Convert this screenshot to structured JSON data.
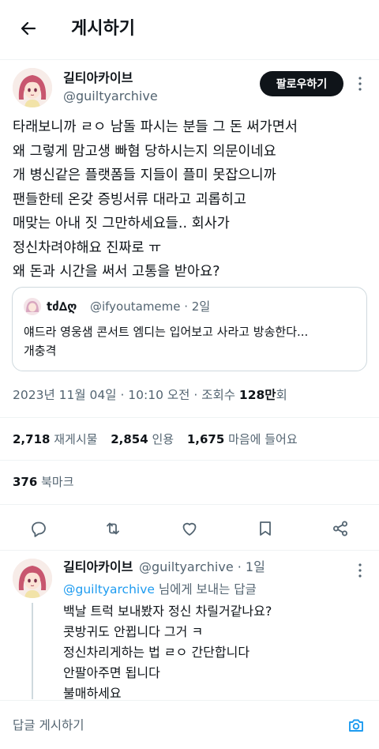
{
  "header": {
    "title": "게시하기",
    "back_icon": "arrow-left-icon"
  },
  "tweet": {
    "author_name": "길티아카이브",
    "author_handle": "@guiltyarchive",
    "follow_label": "팔로우하기",
    "body_lines": [
      "타래보니까 ㄹㅇ 남돌 파시는 분들 그 돈 써가면서",
      "왜 그렇게 맘고생 빠혐 당하시는지 의문이네요",
      "개 병신같은 플랫폼들 지들이 플미 못잡으니까",
      "팬들한테 온갖 증빙서류 대라고 괴롭히고",
      "매맞는 아내 짓 그만하세요들.. 회사가",
      "정신차려야해요 진짜로 ㅠ",
      "왜 돈과 시간을 써서 고통을 받아요?"
    ],
    "quote": {
      "name": "tძ∆ღ",
      "handle": "@ifyoutameme · 2일",
      "text_lines": [
        "얘드라 영웅샘 콘서트 엠디는 입어보고 사라고 방송한다...",
        "개충격"
      ]
    },
    "meta": {
      "datetime": "2023년 11월 04일 · 10:10 오전 · 조회수 ",
      "views": "128만",
      "views_unit": "회"
    },
    "stats": {
      "retweets": "2,718",
      "retweets_label": "재게시물",
      "quotes": "2,854",
      "quotes_label": "인용",
      "likes": "1,675",
      "likes_label": "마음에 들어요"
    },
    "bookmarks": {
      "count": "376",
      "label": "북마크"
    }
  },
  "actions": [
    "reply-icon",
    "retweet-icon",
    "like-icon",
    "bookmark-icon",
    "share-icon"
  ],
  "reply": {
    "author_name": "길티아카이브",
    "author_handle_time": "@guiltyarchive · 1일",
    "mention": "@guiltyarchive",
    "reply_to_suffix": " 님에게 보내는 답글",
    "body_lines": [
      "백날 트럭 보내봤자 정신 차릴거같나요?",
      "콧방귀도 안뀝니다 그거 ㅋ",
      "정신차리게하는 법 ㄹㅇ 간단합니다",
      "안팔아주면 됩니다",
      "불매하세요"
    ]
  },
  "compose": {
    "placeholder": "답글 게시하기"
  },
  "colors": {
    "accent": "#1d9bf0",
    "text": "#0f1419",
    "secondary": "#536471"
  }
}
